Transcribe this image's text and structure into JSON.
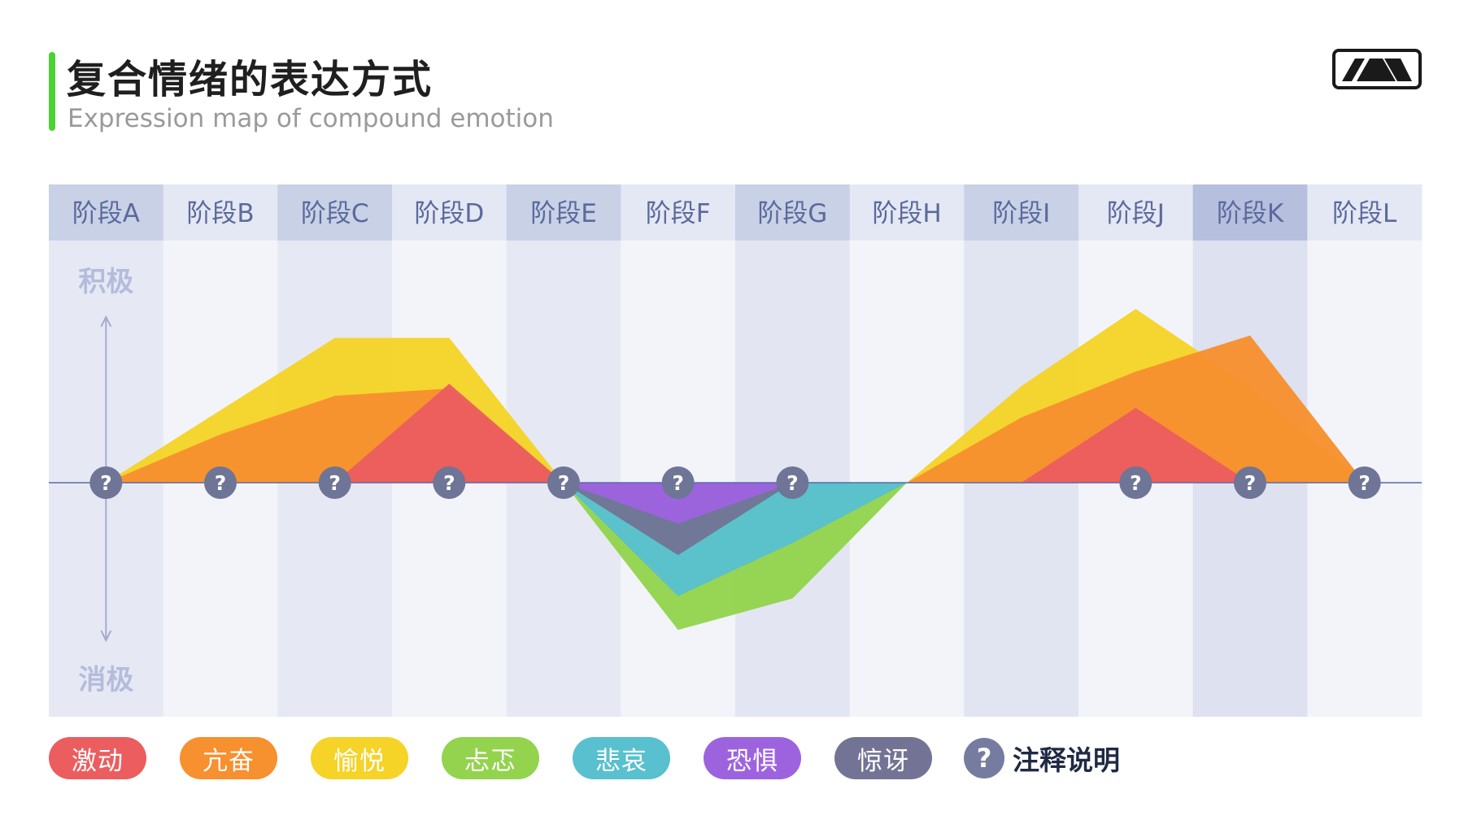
{
  "title": "复合情绪的表达方式",
  "subtitle": "Expression map of compound emotion",
  "logo_icon": "mountain-logo-icon",
  "chart_data": {
    "type": "area",
    "categories": [
      "阶段A",
      "阶段B",
      "阶段C",
      "阶段D",
      "阶段E",
      "阶段F",
      "阶段G",
      "阶段H",
      "阶段I",
      "阶段J",
      "阶段K",
      "阶段L"
    ],
    "ylabel_top": "积极",
    "ylabel_bottom": "消极",
    "ylim": [
      -1,
      1
    ],
    "grid": false,
    "legend_position": "bottom",
    "series": [
      {
        "name": "愉悦",
        "color": "#f5d327",
        "values": [
          0,
          0.3,
          0.6,
          0.6,
          0,
          0,
          0,
          0,
          0.4,
          0.72,
          0.4,
          0
        ]
      },
      {
        "name": "亢奋",
        "color": "#f7902e",
        "values": [
          0,
          0.2,
          0.36,
          0.39,
          0,
          0,
          0,
          0,
          0.27,
          0.46,
          0.61,
          0
        ]
      },
      {
        "name": "激动",
        "color": "#eb5d5f",
        "values": [
          0,
          0,
          0,
          0.41,
          0,
          0,
          0,
          0,
          0,
          0.31,
          0,
          0
        ]
      },
      {
        "name": "忐忑",
        "color": "#93d34d",
        "values": [
          0,
          0,
          0,
          0,
          0,
          -0.61,
          -0.48,
          0,
          0,
          0,
          0,
          0
        ]
      },
      {
        "name": "悲哀",
        "color": "#58c0cf",
        "values": [
          0,
          0,
          0,
          0,
          0,
          -0.47,
          -0.25,
          0,
          0,
          0,
          0,
          0
        ]
      },
      {
        "name": "惊讶",
        "color": "#737495",
        "values": [
          0,
          0,
          0,
          0,
          0,
          -0.3,
          0,
          0,
          0,
          0,
          0,
          0
        ]
      },
      {
        "name": "恐惧",
        "color": "#9d63df",
        "values": [
          0,
          0,
          0,
          0,
          0,
          -0.17,
          0,
          0,
          0,
          0,
          0,
          0
        ]
      }
    ],
    "note_markers_at": [
      "阶段A",
      "阶段B",
      "阶段C",
      "阶段D",
      "阶段E",
      "阶段F",
      "阶段G",
      "阶段J",
      "阶段K",
      "阶段L"
    ],
    "note_symbol": "?"
  },
  "legend": [
    {
      "label": "激动",
      "color": "#eb5d5f"
    },
    {
      "label": "亢奋",
      "color": "#f7902e"
    },
    {
      "label": "愉悦",
      "color": "#f5d327"
    },
    {
      "label": "忐忑",
      "color": "#93d34d"
    },
    {
      "label": "悲哀",
      "color": "#58c0cf"
    },
    {
      "label": "恐惧",
      "color": "#9d63df"
    },
    {
      "label": "惊讶",
      "color": "#737495"
    }
  ],
  "note_legend": {
    "symbol": "?",
    "label": "注释说明"
  }
}
